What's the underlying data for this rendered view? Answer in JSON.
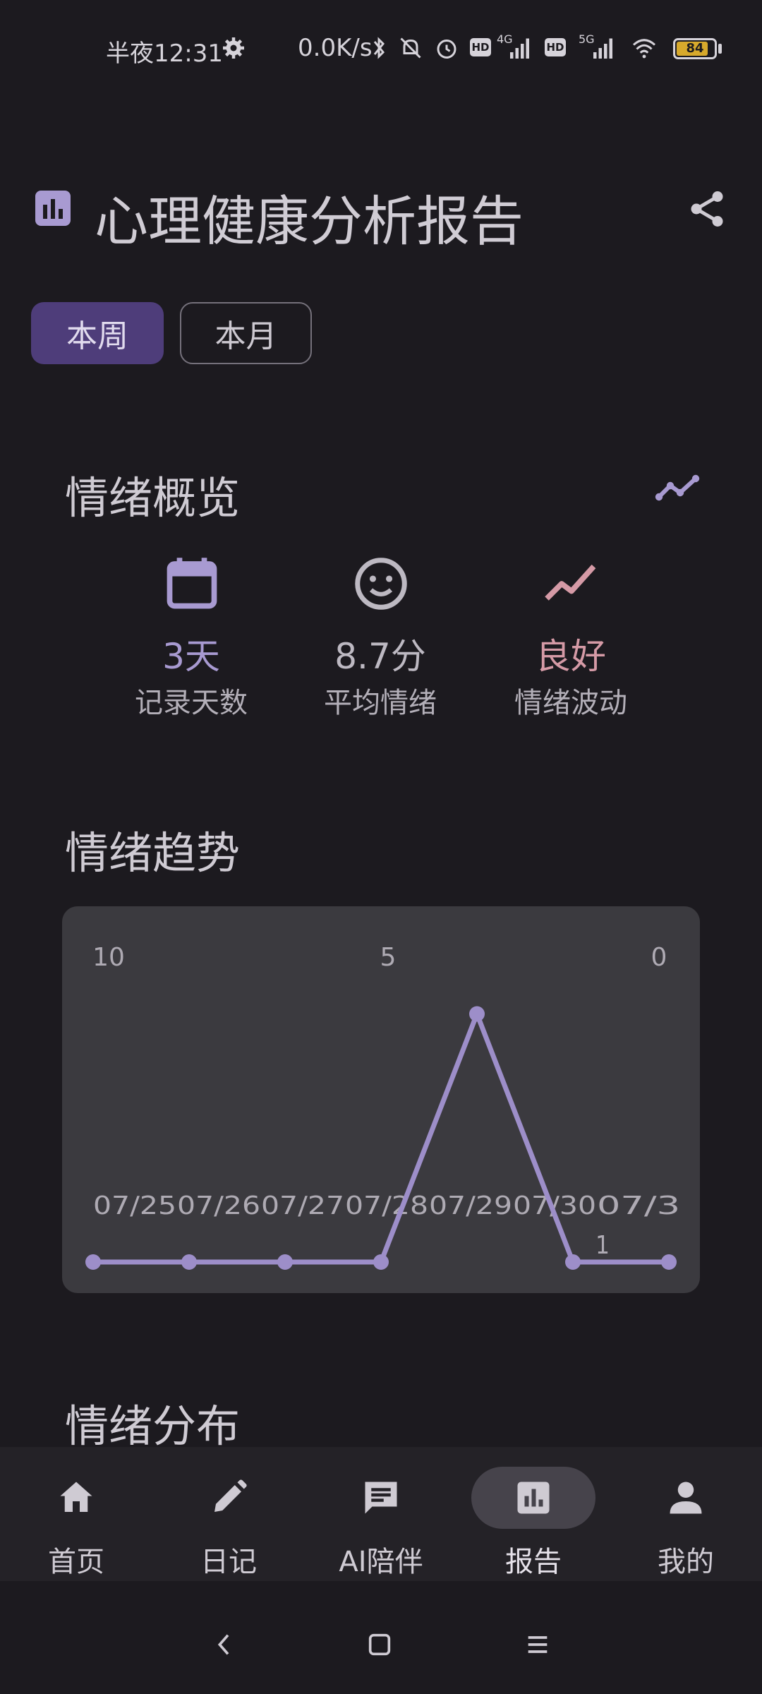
{
  "status_bar": {
    "time": "半夜12:31",
    "network_speed": "0.0K/s",
    "network_4g": "4G",
    "network_5g": "5G",
    "hd_label": "HD",
    "battery": "84"
  },
  "header": {
    "title": "心理健康分析报告"
  },
  "period_tabs": [
    {
      "label": "本周",
      "selected": true
    },
    {
      "label": "本月",
      "selected": false
    }
  ],
  "overview": {
    "title": "情绪概览",
    "stats": [
      {
        "icon": "calendar-icon",
        "value": "3天",
        "label": "记录天数",
        "color": "#a89ad1"
      },
      {
        "icon": "smiley-icon",
        "value": "8.7分",
        "label": "平均情绪",
        "color": "#bdb9c2"
      },
      {
        "icon": "trend-icon",
        "value": "良好",
        "label": "情绪波动",
        "color": "#d59aa6"
      }
    ]
  },
  "trend": {
    "title": "情绪趋势"
  },
  "chart_data": {
    "type": "line",
    "categories": [
      "07/25",
      "07/26",
      "07/27",
      "07/28",
      "07/29",
      "07/30",
      "07/31"
    ],
    "values": [
      0,
      0,
      0,
      0,
      8.7,
      0,
      0
    ],
    "y_tick_labels": [
      "10",
      "5",
      "0"
    ],
    "x_tick_labels": [
      "07/25",
      "07/26",
      "07/27",
      "07/28",
      "07/29",
      "07/30",
      "07/3",
      "1"
    ],
    "ylim": [
      0,
      10
    ],
    "grid": false,
    "line_color": "#9d8ec9"
  },
  "distribution": {
    "title": "情绪分布"
  },
  "bottom_nav": [
    {
      "icon": "home-icon",
      "label": "首页",
      "active": false
    },
    {
      "icon": "pencil-icon",
      "label": "日记",
      "active": false
    },
    {
      "icon": "chat-icon",
      "label": "AI陪伴",
      "active": false
    },
    {
      "icon": "report-icon",
      "label": "报告",
      "active": true
    },
    {
      "icon": "person-icon",
      "label": "我的",
      "active": false
    }
  ]
}
